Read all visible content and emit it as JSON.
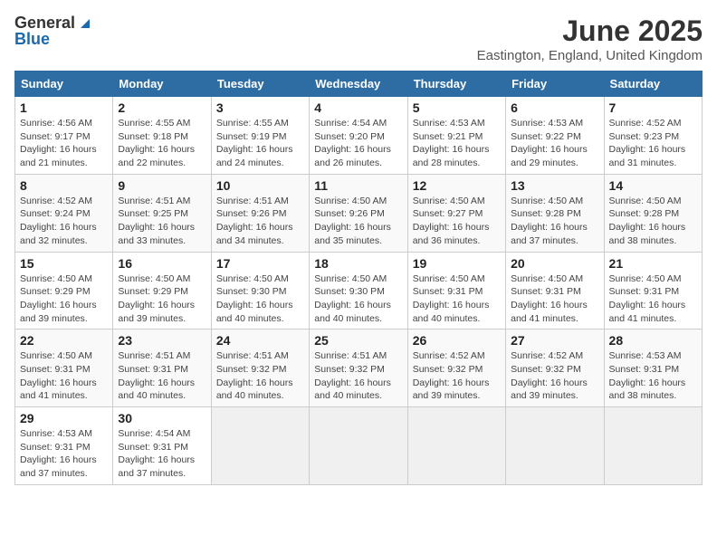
{
  "header": {
    "logo_general": "General",
    "logo_blue": "Blue",
    "month_year": "June 2025",
    "location": "Eastington, England, United Kingdom"
  },
  "calendar": {
    "days_of_week": [
      "Sunday",
      "Monday",
      "Tuesday",
      "Wednesday",
      "Thursday",
      "Friday",
      "Saturday"
    ],
    "weeks": [
      [
        null,
        {
          "day": 2,
          "sunrise": "4:55 AM",
          "sunset": "9:18 PM",
          "daylight": "16 hours and 22 minutes."
        },
        {
          "day": 3,
          "sunrise": "4:55 AM",
          "sunset": "9:19 PM",
          "daylight": "16 hours and 24 minutes."
        },
        {
          "day": 4,
          "sunrise": "4:54 AM",
          "sunset": "9:20 PM",
          "daylight": "16 hours and 26 minutes."
        },
        {
          "day": 5,
          "sunrise": "4:53 AM",
          "sunset": "9:21 PM",
          "daylight": "16 hours and 28 minutes."
        },
        {
          "day": 6,
          "sunrise": "4:53 AM",
          "sunset": "9:22 PM",
          "daylight": "16 hours and 29 minutes."
        },
        {
          "day": 7,
          "sunrise": "4:52 AM",
          "sunset": "9:23 PM",
          "daylight": "16 hours and 31 minutes."
        }
      ],
      [
        {
          "day": 1,
          "sunrise": "4:56 AM",
          "sunset": "9:17 PM",
          "daylight": "16 hours and 21 minutes."
        },
        {
          "day": 9,
          "sunrise": "4:51 AM",
          "sunset": "9:25 PM",
          "daylight": "16 hours and 33 minutes."
        },
        {
          "day": 10,
          "sunrise": "4:51 AM",
          "sunset": "9:26 PM",
          "daylight": "16 hours and 34 minutes."
        },
        {
          "day": 11,
          "sunrise": "4:50 AM",
          "sunset": "9:26 PM",
          "daylight": "16 hours and 35 minutes."
        },
        {
          "day": 12,
          "sunrise": "4:50 AM",
          "sunset": "9:27 PM",
          "daylight": "16 hours and 36 minutes."
        },
        {
          "day": 13,
          "sunrise": "4:50 AM",
          "sunset": "9:28 PM",
          "daylight": "16 hours and 37 minutes."
        },
        {
          "day": 14,
          "sunrise": "4:50 AM",
          "sunset": "9:28 PM",
          "daylight": "16 hours and 38 minutes."
        }
      ],
      [
        {
          "day": 8,
          "sunrise": "4:52 AM",
          "sunset": "9:24 PM",
          "daylight": "16 hours and 32 minutes."
        },
        {
          "day": 16,
          "sunrise": "4:50 AM",
          "sunset": "9:29 PM",
          "daylight": "16 hours and 39 minutes."
        },
        {
          "day": 17,
          "sunrise": "4:50 AM",
          "sunset": "9:30 PM",
          "daylight": "16 hours and 40 minutes."
        },
        {
          "day": 18,
          "sunrise": "4:50 AM",
          "sunset": "9:30 PM",
          "daylight": "16 hours and 40 minutes."
        },
        {
          "day": 19,
          "sunrise": "4:50 AM",
          "sunset": "9:31 PM",
          "daylight": "16 hours and 40 minutes."
        },
        {
          "day": 20,
          "sunrise": "4:50 AM",
          "sunset": "9:31 PM",
          "daylight": "16 hours and 41 minutes."
        },
        {
          "day": 21,
          "sunrise": "4:50 AM",
          "sunset": "9:31 PM",
          "daylight": "16 hours and 41 minutes."
        }
      ],
      [
        {
          "day": 15,
          "sunrise": "4:50 AM",
          "sunset": "9:29 PM",
          "daylight": "16 hours and 39 minutes."
        },
        {
          "day": 23,
          "sunrise": "4:51 AM",
          "sunset": "9:31 PM",
          "daylight": "16 hours and 40 minutes."
        },
        {
          "day": 24,
          "sunrise": "4:51 AM",
          "sunset": "9:32 PM",
          "daylight": "16 hours and 40 minutes."
        },
        {
          "day": 25,
          "sunrise": "4:51 AM",
          "sunset": "9:32 PM",
          "daylight": "16 hours and 40 minutes."
        },
        {
          "day": 26,
          "sunrise": "4:52 AM",
          "sunset": "9:32 PM",
          "daylight": "16 hours and 39 minutes."
        },
        {
          "day": 27,
          "sunrise": "4:52 AM",
          "sunset": "9:32 PM",
          "daylight": "16 hours and 39 minutes."
        },
        {
          "day": 28,
          "sunrise": "4:53 AM",
          "sunset": "9:31 PM",
          "daylight": "16 hours and 38 minutes."
        }
      ],
      [
        {
          "day": 22,
          "sunrise": "4:50 AM",
          "sunset": "9:31 PM",
          "daylight": "16 hours and 41 minutes."
        },
        {
          "day": 30,
          "sunrise": "4:54 AM",
          "sunset": "9:31 PM",
          "daylight": "16 hours and 37 minutes."
        },
        null,
        null,
        null,
        null,
        null
      ],
      [
        {
          "day": 29,
          "sunrise": "4:53 AM",
          "sunset": "9:31 PM",
          "daylight": "16 hours and 37 minutes."
        },
        null,
        null,
        null,
        null,
        null,
        null
      ]
    ],
    "week_row_map": [
      [
        null,
        1,
        2,
        3,
        4,
        5,
        6,
        7
      ],
      [
        8,
        9,
        10,
        11,
        12,
        13,
        14
      ],
      [
        15,
        16,
        17,
        18,
        19,
        20,
        21
      ],
      [
        22,
        23,
        24,
        25,
        26,
        27,
        28
      ],
      [
        29,
        30,
        null,
        null,
        null,
        null,
        null
      ]
    ]
  },
  "cells": {
    "1": {
      "sunrise": "Sunrise: 4:56 AM",
      "sunset": "Sunset: 9:17 PM",
      "daylight": "Daylight: 16 hours and 21 minutes."
    },
    "2": {
      "sunrise": "Sunrise: 4:55 AM",
      "sunset": "Sunset: 9:18 PM",
      "daylight": "Daylight: 16 hours and 22 minutes."
    },
    "3": {
      "sunrise": "Sunrise: 4:55 AM",
      "sunset": "Sunset: 9:19 PM",
      "daylight": "Daylight: 16 hours and 24 minutes."
    },
    "4": {
      "sunrise": "Sunrise: 4:54 AM",
      "sunset": "Sunset: 9:20 PM",
      "daylight": "Daylight: 16 hours and 26 minutes."
    },
    "5": {
      "sunrise": "Sunrise: 4:53 AM",
      "sunset": "Sunset: 9:21 PM",
      "daylight": "Daylight: 16 hours and 28 minutes."
    },
    "6": {
      "sunrise": "Sunrise: 4:53 AM",
      "sunset": "Sunset: 9:22 PM",
      "daylight": "Daylight: 16 hours and 29 minutes."
    },
    "7": {
      "sunrise": "Sunrise: 4:52 AM",
      "sunset": "Sunset: 9:23 PM",
      "daylight": "Daylight: 16 hours and 31 minutes."
    },
    "8": {
      "sunrise": "Sunrise: 4:52 AM",
      "sunset": "Sunset: 9:24 PM",
      "daylight": "Daylight: 16 hours and 32 minutes."
    },
    "9": {
      "sunrise": "Sunrise: 4:51 AM",
      "sunset": "Sunset: 9:25 PM",
      "daylight": "Daylight: 16 hours and 33 minutes."
    },
    "10": {
      "sunrise": "Sunrise: 4:51 AM",
      "sunset": "Sunset: 9:26 PM",
      "daylight": "Daylight: 16 hours and 34 minutes."
    },
    "11": {
      "sunrise": "Sunrise: 4:50 AM",
      "sunset": "Sunset: 9:26 PM",
      "daylight": "Daylight: 16 hours and 35 minutes."
    },
    "12": {
      "sunrise": "Sunrise: 4:50 AM",
      "sunset": "Sunset: 9:27 PM",
      "daylight": "Daylight: 16 hours and 36 minutes."
    },
    "13": {
      "sunrise": "Sunrise: 4:50 AM",
      "sunset": "Sunset: 9:28 PM",
      "daylight": "Daylight: 16 hours and 37 minutes."
    },
    "14": {
      "sunrise": "Sunrise: 4:50 AM",
      "sunset": "Sunset: 9:28 PM",
      "daylight": "Daylight: 16 hours and 38 minutes."
    },
    "15": {
      "sunrise": "Sunrise: 4:50 AM",
      "sunset": "Sunset: 9:29 PM",
      "daylight": "Daylight: 16 hours and 39 minutes."
    },
    "16": {
      "sunrise": "Sunrise: 4:50 AM",
      "sunset": "Sunset: 9:29 PM",
      "daylight": "Daylight: 16 hours and 39 minutes."
    },
    "17": {
      "sunrise": "Sunrise: 4:50 AM",
      "sunset": "Sunset: 9:30 PM",
      "daylight": "Daylight: 16 hours and 40 minutes."
    },
    "18": {
      "sunrise": "Sunrise: 4:50 AM",
      "sunset": "Sunset: 9:30 PM",
      "daylight": "Daylight: 16 hours and 40 minutes."
    },
    "19": {
      "sunrise": "Sunrise: 4:50 AM",
      "sunset": "Sunset: 9:31 PM",
      "daylight": "Daylight: 16 hours and 40 minutes."
    },
    "20": {
      "sunrise": "Sunrise: 4:50 AM",
      "sunset": "Sunset: 9:31 PM",
      "daylight": "Daylight: 16 hours and 41 minutes."
    },
    "21": {
      "sunrise": "Sunrise: 4:50 AM",
      "sunset": "Sunset: 9:31 PM",
      "daylight": "Daylight: 16 hours and 41 minutes."
    },
    "22": {
      "sunrise": "Sunrise: 4:50 AM",
      "sunset": "Sunset: 9:31 PM",
      "daylight": "Daylight: 16 hours and 41 minutes."
    },
    "23": {
      "sunrise": "Sunrise: 4:51 AM",
      "sunset": "Sunset: 9:31 PM",
      "daylight": "Daylight: 16 hours and 40 minutes."
    },
    "24": {
      "sunrise": "Sunrise: 4:51 AM",
      "sunset": "Sunset: 9:32 PM",
      "daylight": "Daylight: 16 hours and 40 minutes."
    },
    "25": {
      "sunrise": "Sunrise: 4:51 AM",
      "sunset": "Sunset: 9:32 PM",
      "daylight": "Daylight: 16 hours and 40 minutes."
    },
    "26": {
      "sunrise": "Sunrise: 4:52 AM",
      "sunset": "Sunset: 9:32 PM",
      "daylight": "Daylight: 16 hours and 39 minutes."
    },
    "27": {
      "sunrise": "Sunrise: 4:52 AM",
      "sunset": "Sunset: 9:32 PM",
      "daylight": "Daylight: 16 hours and 39 minutes."
    },
    "28": {
      "sunrise": "Sunrise: 4:53 AM",
      "sunset": "Sunset: 9:31 PM",
      "daylight": "Daylight: 16 hours and 38 minutes."
    },
    "29": {
      "sunrise": "Sunrise: 4:53 AM",
      "sunset": "Sunset: 9:31 PM",
      "daylight": "Daylight: 16 hours and 37 minutes."
    },
    "30": {
      "sunrise": "Sunrise: 4:54 AM",
      "sunset": "Sunset: 9:31 PM",
      "daylight": "Daylight: 16 hours and 37 minutes."
    }
  }
}
